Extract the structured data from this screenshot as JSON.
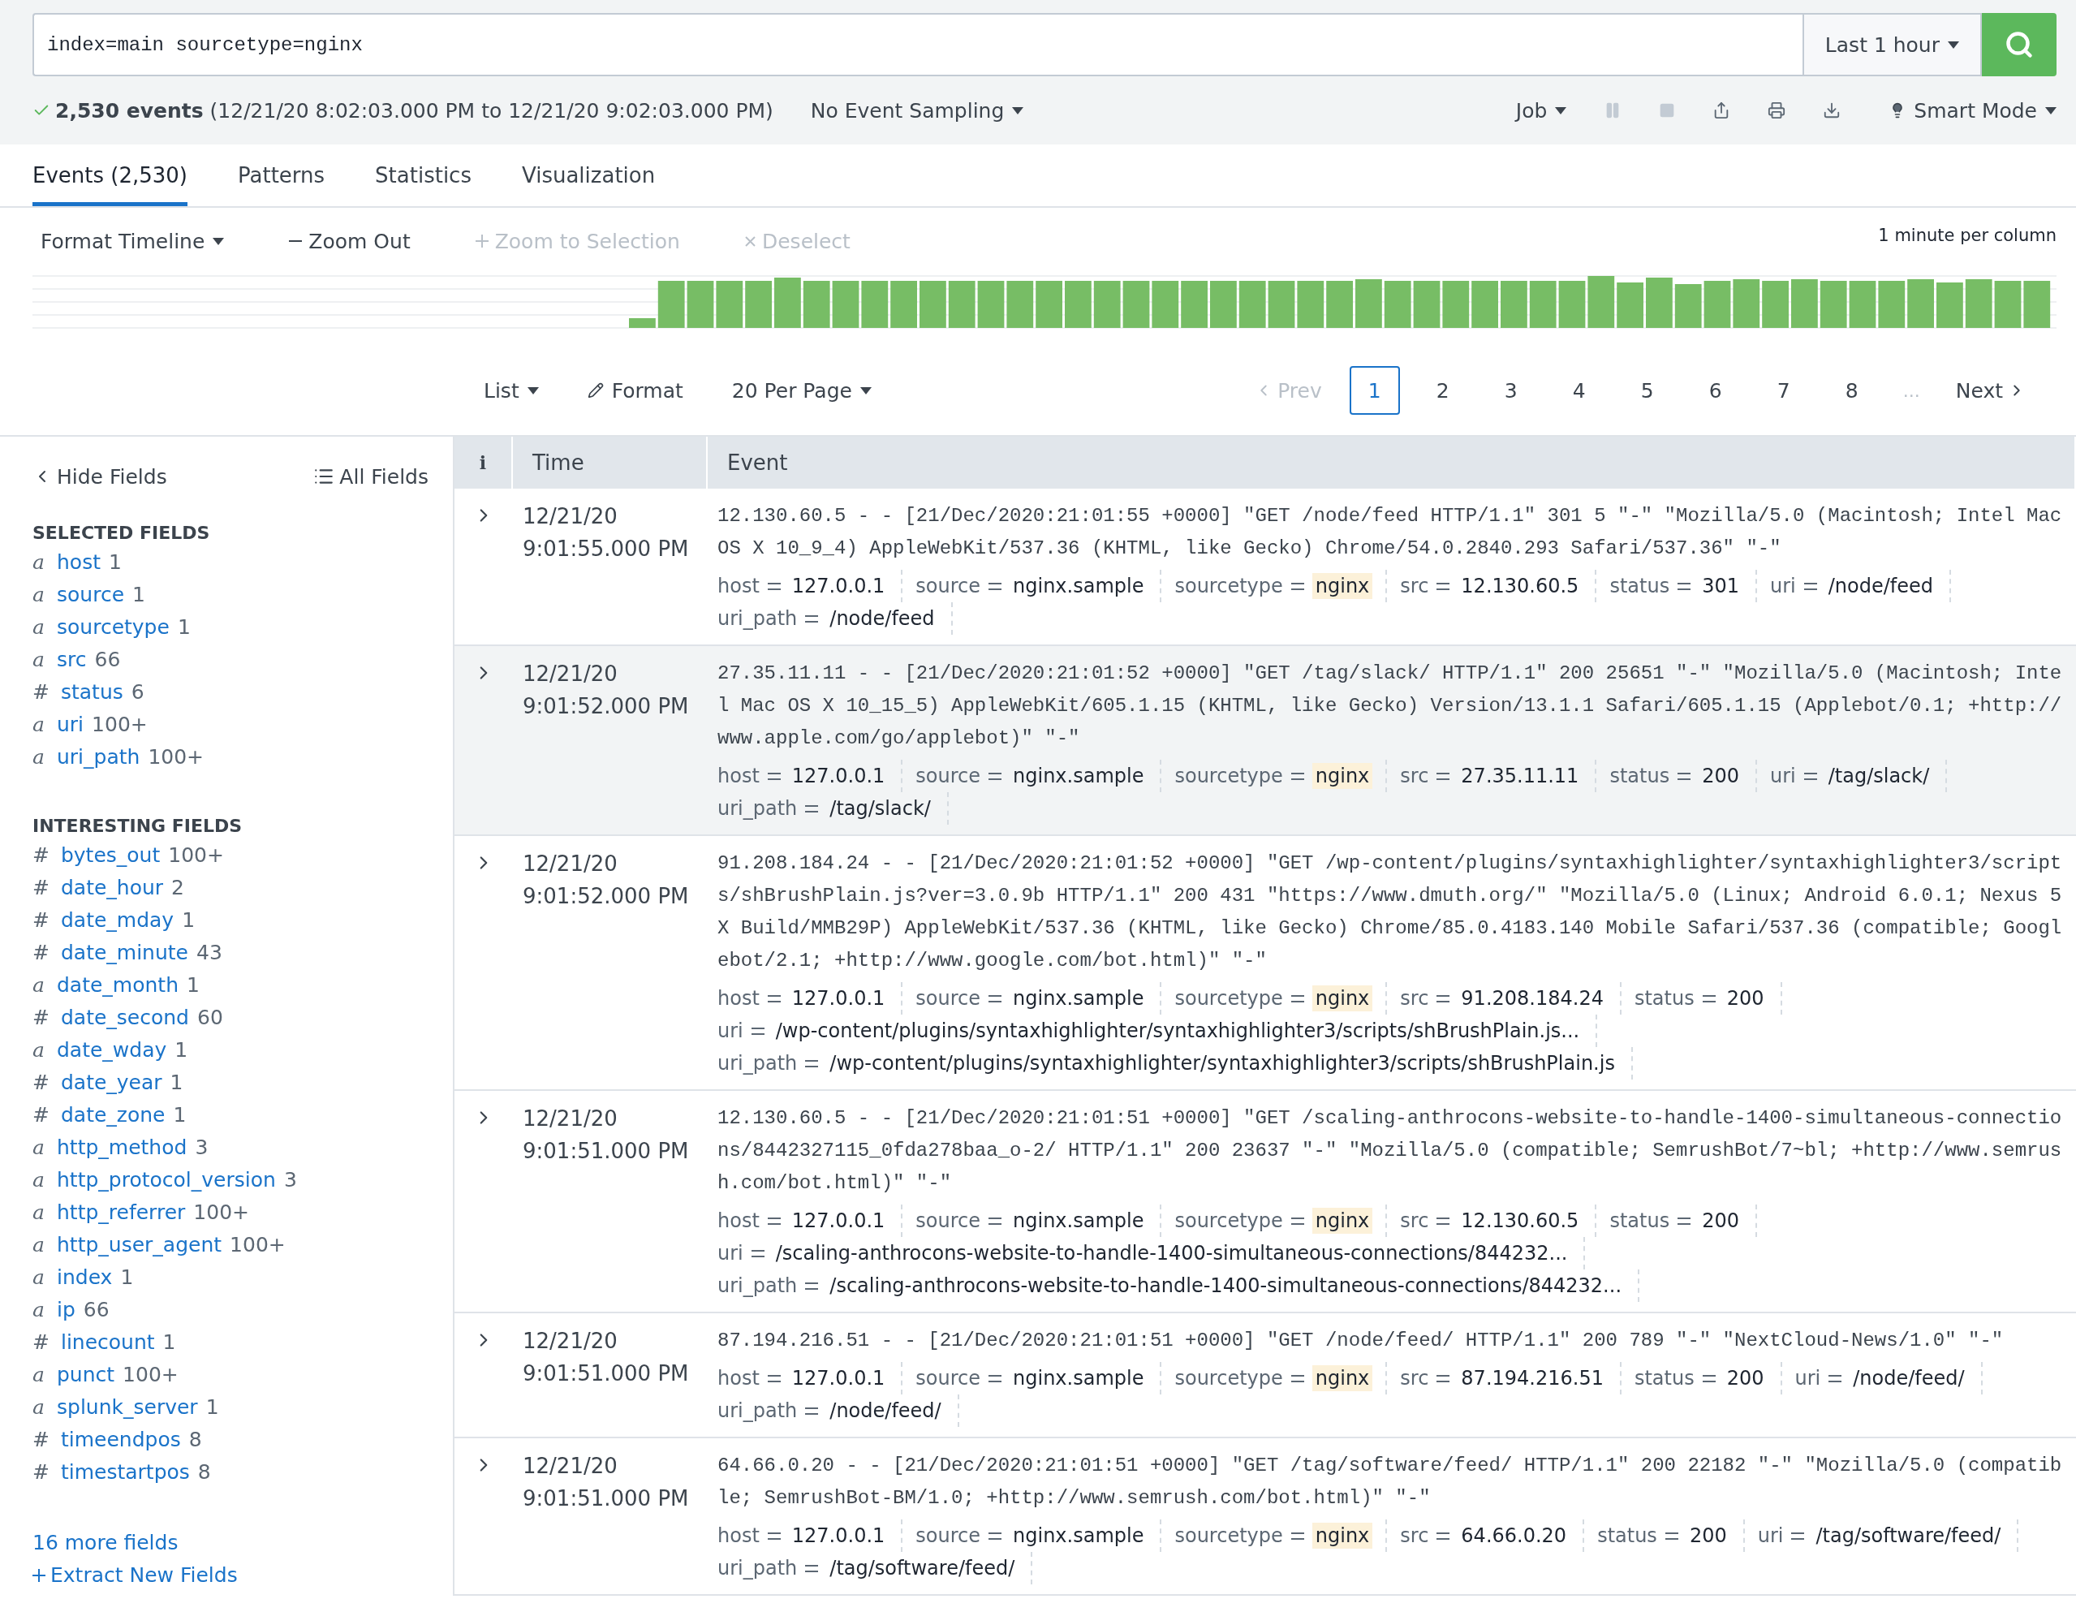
{
  "search": {
    "query": "index=main sourcetype=nginx",
    "time_range": "Last 1 hour"
  },
  "status": {
    "count": "2,530 events",
    "range": "(12/21/20 8:02:03.000 PM to 12/21/20 9:02:03.000 PM)",
    "sampling": "No Event Sampling",
    "job": "Job",
    "mode": "Smart Mode"
  },
  "tabs": [
    {
      "label": "Events (2,530)",
      "selected": true
    },
    {
      "label": "Patterns",
      "selected": false
    },
    {
      "label": "Statistics",
      "selected": false
    },
    {
      "label": "Visualization",
      "selected": false
    }
  ],
  "timeline": {
    "format": "Format Timeline",
    "actions": [
      {
        "label": "Zoom Out",
        "kind": "minus",
        "disabled": false
      },
      {
        "label": "Zoom to Selection",
        "kind": "plus",
        "disabled": true
      },
      {
        "label": "Deselect",
        "kind": "x",
        "disabled": true
      }
    ],
    "scale": "1 minute per column"
  },
  "results_bar": {
    "view": "List",
    "format": "Format",
    "per_page": "20 Per Page",
    "prev": "Prev",
    "pages": [
      {
        "label": "1",
        "selected": true
      },
      {
        "label": "2",
        "selected": false
      },
      {
        "label": "3",
        "selected": false
      },
      {
        "label": "4",
        "selected": false
      },
      {
        "label": "5",
        "selected": false
      },
      {
        "label": "6",
        "selected": false
      },
      {
        "label": "7",
        "selected": false
      },
      {
        "label": "8",
        "selected": false
      }
    ],
    "ellipsis": "...",
    "next": "Next"
  },
  "sidebar": {
    "hide": "Hide Fields",
    "all": "All Fields",
    "selected_title": "SELECTED FIELDS",
    "selected_fields": [
      {
        "type": "a",
        "name": "host",
        "count": "1"
      },
      {
        "type": "a",
        "name": "source",
        "count": "1"
      },
      {
        "type": "a",
        "name": "sourcetype",
        "count": "1"
      },
      {
        "type": "a",
        "name": "src",
        "count": "66"
      },
      {
        "type": "#",
        "name": "status",
        "count": "6"
      },
      {
        "type": "a",
        "name": "uri",
        "count": "100+"
      },
      {
        "type": "a",
        "name": "uri_path",
        "count": "100+"
      }
    ],
    "interesting_title": "INTERESTING FIELDS",
    "interesting_fields": [
      {
        "type": "#",
        "name": "bytes_out",
        "count": "100+"
      },
      {
        "type": "#",
        "name": "date_hour",
        "count": "2"
      },
      {
        "type": "#",
        "name": "date_mday",
        "count": "1"
      },
      {
        "type": "#",
        "name": "date_minute",
        "count": "43"
      },
      {
        "type": "a",
        "name": "date_month",
        "count": "1"
      },
      {
        "type": "#",
        "name": "date_second",
        "count": "60"
      },
      {
        "type": "a",
        "name": "date_wday",
        "count": "1"
      },
      {
        "type": "#",
        "name": "date_year",
        "count": "1"
      },
      {
        "type": "#",
        "name": "date_zone",
        "count": "1"
      },
      {
        "type": "a",
        "name": "http_method",
        "count": "3"
      },
      {
        "type": "a",
        "name": "http_protocol_version",
        "count": "3"
      },
      {
        "type": "a",
        "name": "http_referrer",
        "count": "100+"
      },
      {
        "type": "a",
        "name": "http_user_agent",
        "count": "100+"
      },
      {
        "type": "a",
        "name": "index",
        "count": "1"
      },
      {
        "type": "a",
        "name": "ip",
        "count": "66"
      },
      {
        "type": "#",
        "name": "linecount",
        "count": "1"
      },
      {
        "type": "a",
        "name": "punct",
        "count": "100+"
      },
      {
        "type": "a",
        "name": "splunk_server",
        "count": "1"
      },
      {
        "type": "#",
        "name": "timeendpos",
        "count": "8"
      },
      {
        "type": "#",
        "name": "timestartpos",
        "count": "8"
      }
    ],
    "more": "16 more fields",
    "extract": "Extract New Fields"
  },
  "table": {
    "columns": [
      "i",
      "Time",
      "Event"
    ],
    "rows": [
      {
        "hovered": false,
        "date": "12/21/20",
        "time": "9:01:55.000 PM",
        "raw": "12.130.60.5 - - [21/Dec/2020:21:01:55 +0000] \"GET /node/feed HTTP/1.1\" 301 5 \"-\" \"Mozilla/5.0 (Macintosh; Intel Mac OS X 10_9_4) AppleWebKit/537.36 (KHTML, like Gecko) Chrome/54.0.2840.293 Safari/537.36\" \"-\"",
        "fields": [
          {
            "key": "host",
            "value": "127.0.0.1",
            "highlighted": false
          },
          {
            "key": "source",
            "value": "nginx.sample",
            "highlighted": false
          },
          {
            "key": "sourcetype",
            "value": "nginx",
            "highlighted": true
          },
          {
            "key": "src",
            "value": "12.130.60.5",
            "highlighted": false
          },
          {
            "key": "status",
            "value": "301",
            "highlighted": false
          },
          {
            "key": "uri",
            "value": "/node/feed",
            "highlighted": false
          },
          {
            "key": "uri_path",
            "value": "/node/feed",
            "highlighted": false
          }
        ]
      },
      {
        "hovered": true,
        "date": "12/21/20",
        "time": "9:01:52.000 PM",
        "raw": "27.35.11.11 - - [21/Dec/2020:21:01:52 +0000] \"GET /tag/slack/ HTTP/1.1\" 200 25651 \"-\" \"Mozilla/5.0 (Macintosh; Intel Mac OS X 10_15_5) AppleWebKit/605.1.15 (KHTML, like Gecko) Version/13.1.1 Safari/605.1.15 (Applebot/0.1; +http://www.apple.com/go/applebot)\" \"-\"",
        "fields": [
          {
            "key": "host",
            "value": "127.0.0.1",
            "highlighted": false
          },
          {
            "key": "source",
            "value": "nginx.sample",
            "highlighted": false
          },
          {
            "key": "sourcetype",
            "value": "nginx",
            "highlighted": true
          },
          {
            "key": "src",
            "value": "27.35.11.11",
            "highlighted": false
          },
          {
            "key": "status",
            "value": "200",
            "highlighted": false
          },
          {
            "key": "uri",
            "value": "/tag/slack/",
            "highlighted": false
          },
          {
            "key": "uri_path",
            "value": "/tag/slack/",
            "highlighted": false
          }
        ]
      },
      {
        "hovered": false,
        "date": "12/21/20",
        "time": "9:01:52.000 PM",
        "raw": "91.208.184.24 - - [21/Dec/2020:21:01:52 +0000] \"GET /wp-content/plugins/syntaxhighlighter/syntaxhighlighter3/scripts/shBrushPlain.js?ver=3.0.9b HTTP/1.1\" 200 431 \"https://www.dmuth.org/\" \"Mozilla/5.0 (Linux; Android 6.0.1; Nexus 5X Build/MMB29P) AppleWebKit/537.36 (KHTML, like Gecko) Chrome/85.0.4183.140 Mobile Safari/537.36 (compatible; Googlebot/2.1; +http://www.google.com/bot.html)\" \"-\"",
        "fields": [
          {
            "key": "host",
            "value": "127.0.0.1",
            "highlighted": false
          },
          {
            "key": "source",
            "value": "nginx.sample",
            "highlighted": false
          },
          {
            "key": "sourcetype",
            "value": "nginx",
            "highlighted": true
          },
          {
            "key": "src",
            "value": "91.208.184.24",
            "highlighted": false
          },
          {
            "key": "status",
            "value": "200",
            "highlighted": false
          },
          {
            "key": "uri",
            "value": "/wp-content/plugins/syntaxhighlighter/syntaxhighlighter3/scripts/shBrushPlain.js...",
            "highlighted": false
          },
          {
            "key": "uri_path",
            "value": "/wp-content/plugins/syntaxhighlighter/syntaxhighlighter3/scripts/shBrushPlain.js",
            "highlighted": false
          }
        ]
      },
      {
        "hovered": false,
        "date": "12/21/20",
        "time": "9:01:51.000 PM",
        "raw": "12.130.60.5 - - [21/Dec/2020:21:01:51 +0000] \"GET /scaling-anthrocons-website-to-handle-1400-simultaneous-connections/8442327115_0fda278baa_o-2/ HTTP/1.1\" 200 23637 \"-\" \"Mozilla/5.0 (compatible; SemrushBot/7~bl; +http://www.semrush.com/bot.html)\" \"-\"",
        "fields": [
          {
            "key": "host",
            "value": "127.0.0.1",
            "highlighted": false
          },
          {
            "key": "source",
            "value": "nginx.sample",
            "highlighted": false
          },
          {
            "key": "sourcetype",
            "value": "nginx",
            "highlighted": true
          },
          {
            "key": "src",
            "value": "12.130.60.5",
            "highlighted": false
          },
          {
            "key": "status",
            "value": "200",
            "highlighted": false
          },
          {
            "key": "uri",
            "value": "/scaling-anthrocons-website-to-handle-1400-simultaneous-connections/844232...",
            "highlighted": false
          },
          {
            "key": "uri_path",
            "value": "/scaling-anthrocons-website-to-handle-1400-simultaneous-connections/844232...",
            "highlighted": false
          }
        ]
      },
      {
        "hovered": false,
        "date": "12/21/20",
        "time": "9:01:51.000 PM",
        "raw": "87.194.216.51 - - [21/Dec/2020:21:01:51 +0000] \"GET /node/feed/ HTTP/1.1\" 200 789 \"-\" \"NextCloud-News/1.0\" \"-\"",
        "fields": [
          {
            "key": "host",
            "value": "127.0.0.1",
            "highlighted": false
          },
          {
            "key": "source",
            "value": "nginx.sample",
            "highlighted": false
          },
          {
            "key": "sourcetype",
            "value": "nginx",
            "highlighted": true
          },
          {
            "key": "src",
            "value": "87.194.216.51",
            "highlighted": false
          },
          {
            "key": "status",
            "value": "200",
            "highlighted": false
          },
          {
            "key": "uri",
            "value": "/node/feed/",
            "highlighted": false
          },
          {
            "key": "uri_path",
            "value": "/node/feed/",
            "highlighted": false
          }
        ]
      },
      {
        "hovered": false,
        "date": "12/21/20",
        "time": "9:01:51.000 PM",
        "raw": "64.66.0.20 - - [21/Dec/2020:21:01:51 +0000] \"GET /tag/software/feed/ HTTP/1.1\" 200 22182 \"-\" \"Mozilla/5.0 (compatible; SemrushBot-BM/1.0; +http://www.semrush.com/bot.html)\" \"-\"",
        "fields": [
          {
            "key": "host",
            "value": "127.0.0.1",
            "highlighted": false
          },
          {
            "key": "source",
            "value": "nginx.sample",
            "highlighted": false
          },
          {
            "key": "sourcetype",
            "value": "nginx",
            "highlighted": true
          },
          {
            "key": "src",
            "value": "64.66.0.20",
            "highlighted": false
          },
          {
            "key": "status",
            "value": "200",
            "highlighted": false
          },
          {
            "key": "uri",
            "value": "/tag/software/feed/",
            "highlighted": false
          },
          {
            "key": "uri_path",
            "value": "/tag/software/feed/",
            "highlighted": false
          }
        ]
      }
    ]
  }
}
